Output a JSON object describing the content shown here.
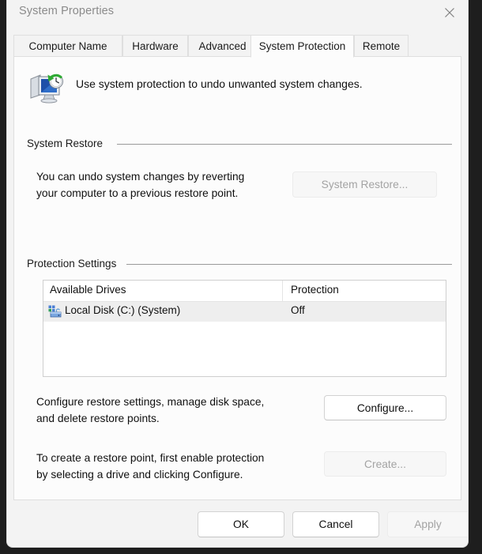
{
  "window": {
    "title": "System Properties",
    "close_icon": "close-icon"
  },
  "tabs": [
    {
      "label": "Computer Name",
      "active": false
    },
    {
      "label": "Hardware",
      "active": false
    },
    {
      "label": "Advanced",
      "active": false
    },
    {
      "label": "System Protection",
      "active": true
    },
    {
      "label": "Remote",
      "active": false
    }
  ],
  "header": {
    "icon": "system-restore-icon",
    "text": "Use system protection to undo unwanted system changes."
  },
  "system_restore_group": {
    "label": "System Restore",
    "description": "You can undo system changes by reverting\nyour computer to a previous restore point.",
    "button_label": "System Restore...",
    "button_enabled": false
  },
  "protection_settings_group": {
    "label": "Protection Settings",
    "columns": [
      "Available Drives",
      "Protection"
    ],
    "rows": [
      {
        "icon": "hard-drive-icon",
        "drive": "Local Disk (C:) (System)",
        "protection": "Off",
        "selected": true
      }
    ],
    "configure": {
      "description": "Configure restore settings, manage disk space,\nand delete restore points.",
      "button_label": "Configure...",
      "button_enabled": true
    },
    "create": {
      "description": "To create a restore point, first enable protection\nby selecting a drive and clicking Configure.",
      "button_label": "Create...",
      "button_enabled": false
    }
  },
  "footer": {
    "ok_label": "OK",
    "cancel_label": "Cancel",
    "apply_label": "Apply",
    "apply_enabled": false
  },
  "colors": {
    "dialog_bg": "#f3f3f3",
    "content_bg": "#fcfcfc",
    "selection_bg": "#eeeeee",
    "text": "#101010",
    "disabled_text": "#a3a3a3",
    "title_text": "#8b8b8b",
    "rule": "#9a9a9a"
  }
}
